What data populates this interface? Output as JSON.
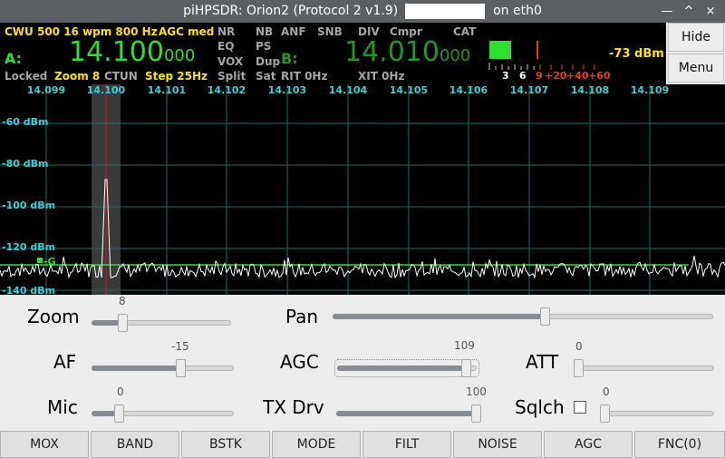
{
  "window": {
    "title": "piHPSDR: Orion2 (Protocol 2 v1.9)",
    "title_suffix": "on eth0",
    "btn_minimize": "—",
    "btn_maximize": "^",
    "btn_restore": "^",
    "btn_close": "×"
  },
  "header": {
    "mode_line": "CWU 500 16 wpm 800 Hz",
    "agc": "AGC med",
    "vfo_a_label": "A:",
    "vfo_a_main": "14.100",
    "vfo_a_sub": "000",
    "vfo_b_label": "B:",
    "vfo_b_main": "14.010",
    "vfo_b_sub": "000",
    "locked": "Locked",
    "zoom": "Zoom 8",
    "ctun": "CTUN",
    "step": "Step 25Hz",
    "flags": {
      "nr": "NR",
      "nb": "NB",
      "anf": "ANF",
      "snb": "SNB",
      "div": "DIV",
      "cmpr": "Cmpr",
      "cat": "CAT",
      "eq": "EQ",
      "ps": "PS",
      "vox": "VOX",
      "dup": "Dup",
      "split": "Split",
      "sat": "Sat",
      "rit": "RIT 0Hz",
      "xit": "XIT 0Hz"
    },
    "meter": {
      "level": "-73 dBm",
      "scale_black": [
        "3",
        "6"
      ],
      "scale_red": [
        "9",
        "+20",
        "+40",
        "+60"
      ],
      "fill_fraction": 0.45
    },
    "hide_label": "Hide",
    "menu_label": "Menu"
  },
  "spectrum": {
    "freq_ticks": [
      "14.099",
      "14.100",
      "14.101",
      "14.102",
      "14.103",
      "14.104",
      "14.105",
      "14.106",
      "14.107",
      "14.108",
      "14.109"
    ],
    "dbm_labels": [
      "-60 dBm",
      "-80 dBm",
      "-100 dBm",
      "-120 dBm",
      "-140 dBm"
    ],
    "marker": "-G",
    "colors": {
      "grid": "#1f6c6c",
      "trace": "#ffffff",
      "ticks": "#3fd0d8",
      "passband": "#3a3a3a",
      "marker": "#2ce02c"
    }
  },
  "controls": {
    "zoom": {
      "label": "Zoom",
      "value": "8"
    },
    "pan": {
      "label": "Pan",
      "value": ""
    },
    "af": {
      "label": "AF",
      "value": "-15"
    },
    "agc": {
      "label": "AGC",
      "value": "109"
    },
    "att": {
      "label": "ATT",
      "value": "0"
    },
    "mic": {
      "label": "Mic",
      "value": "0"
    },
    "txdrv": {
      "label": "TX Drv",
      "value": "100"
    },
    "sqlch": {
      "label": "Sqlch",
      "value": "0"
    }
  },
  "function_buttons": [
    "MOX",
    "BAND",
    "BSTK",
    "MODE",
    "FILT",
    "NOISE",
    "AGC",
    "FNC(0)"
  ]
}
